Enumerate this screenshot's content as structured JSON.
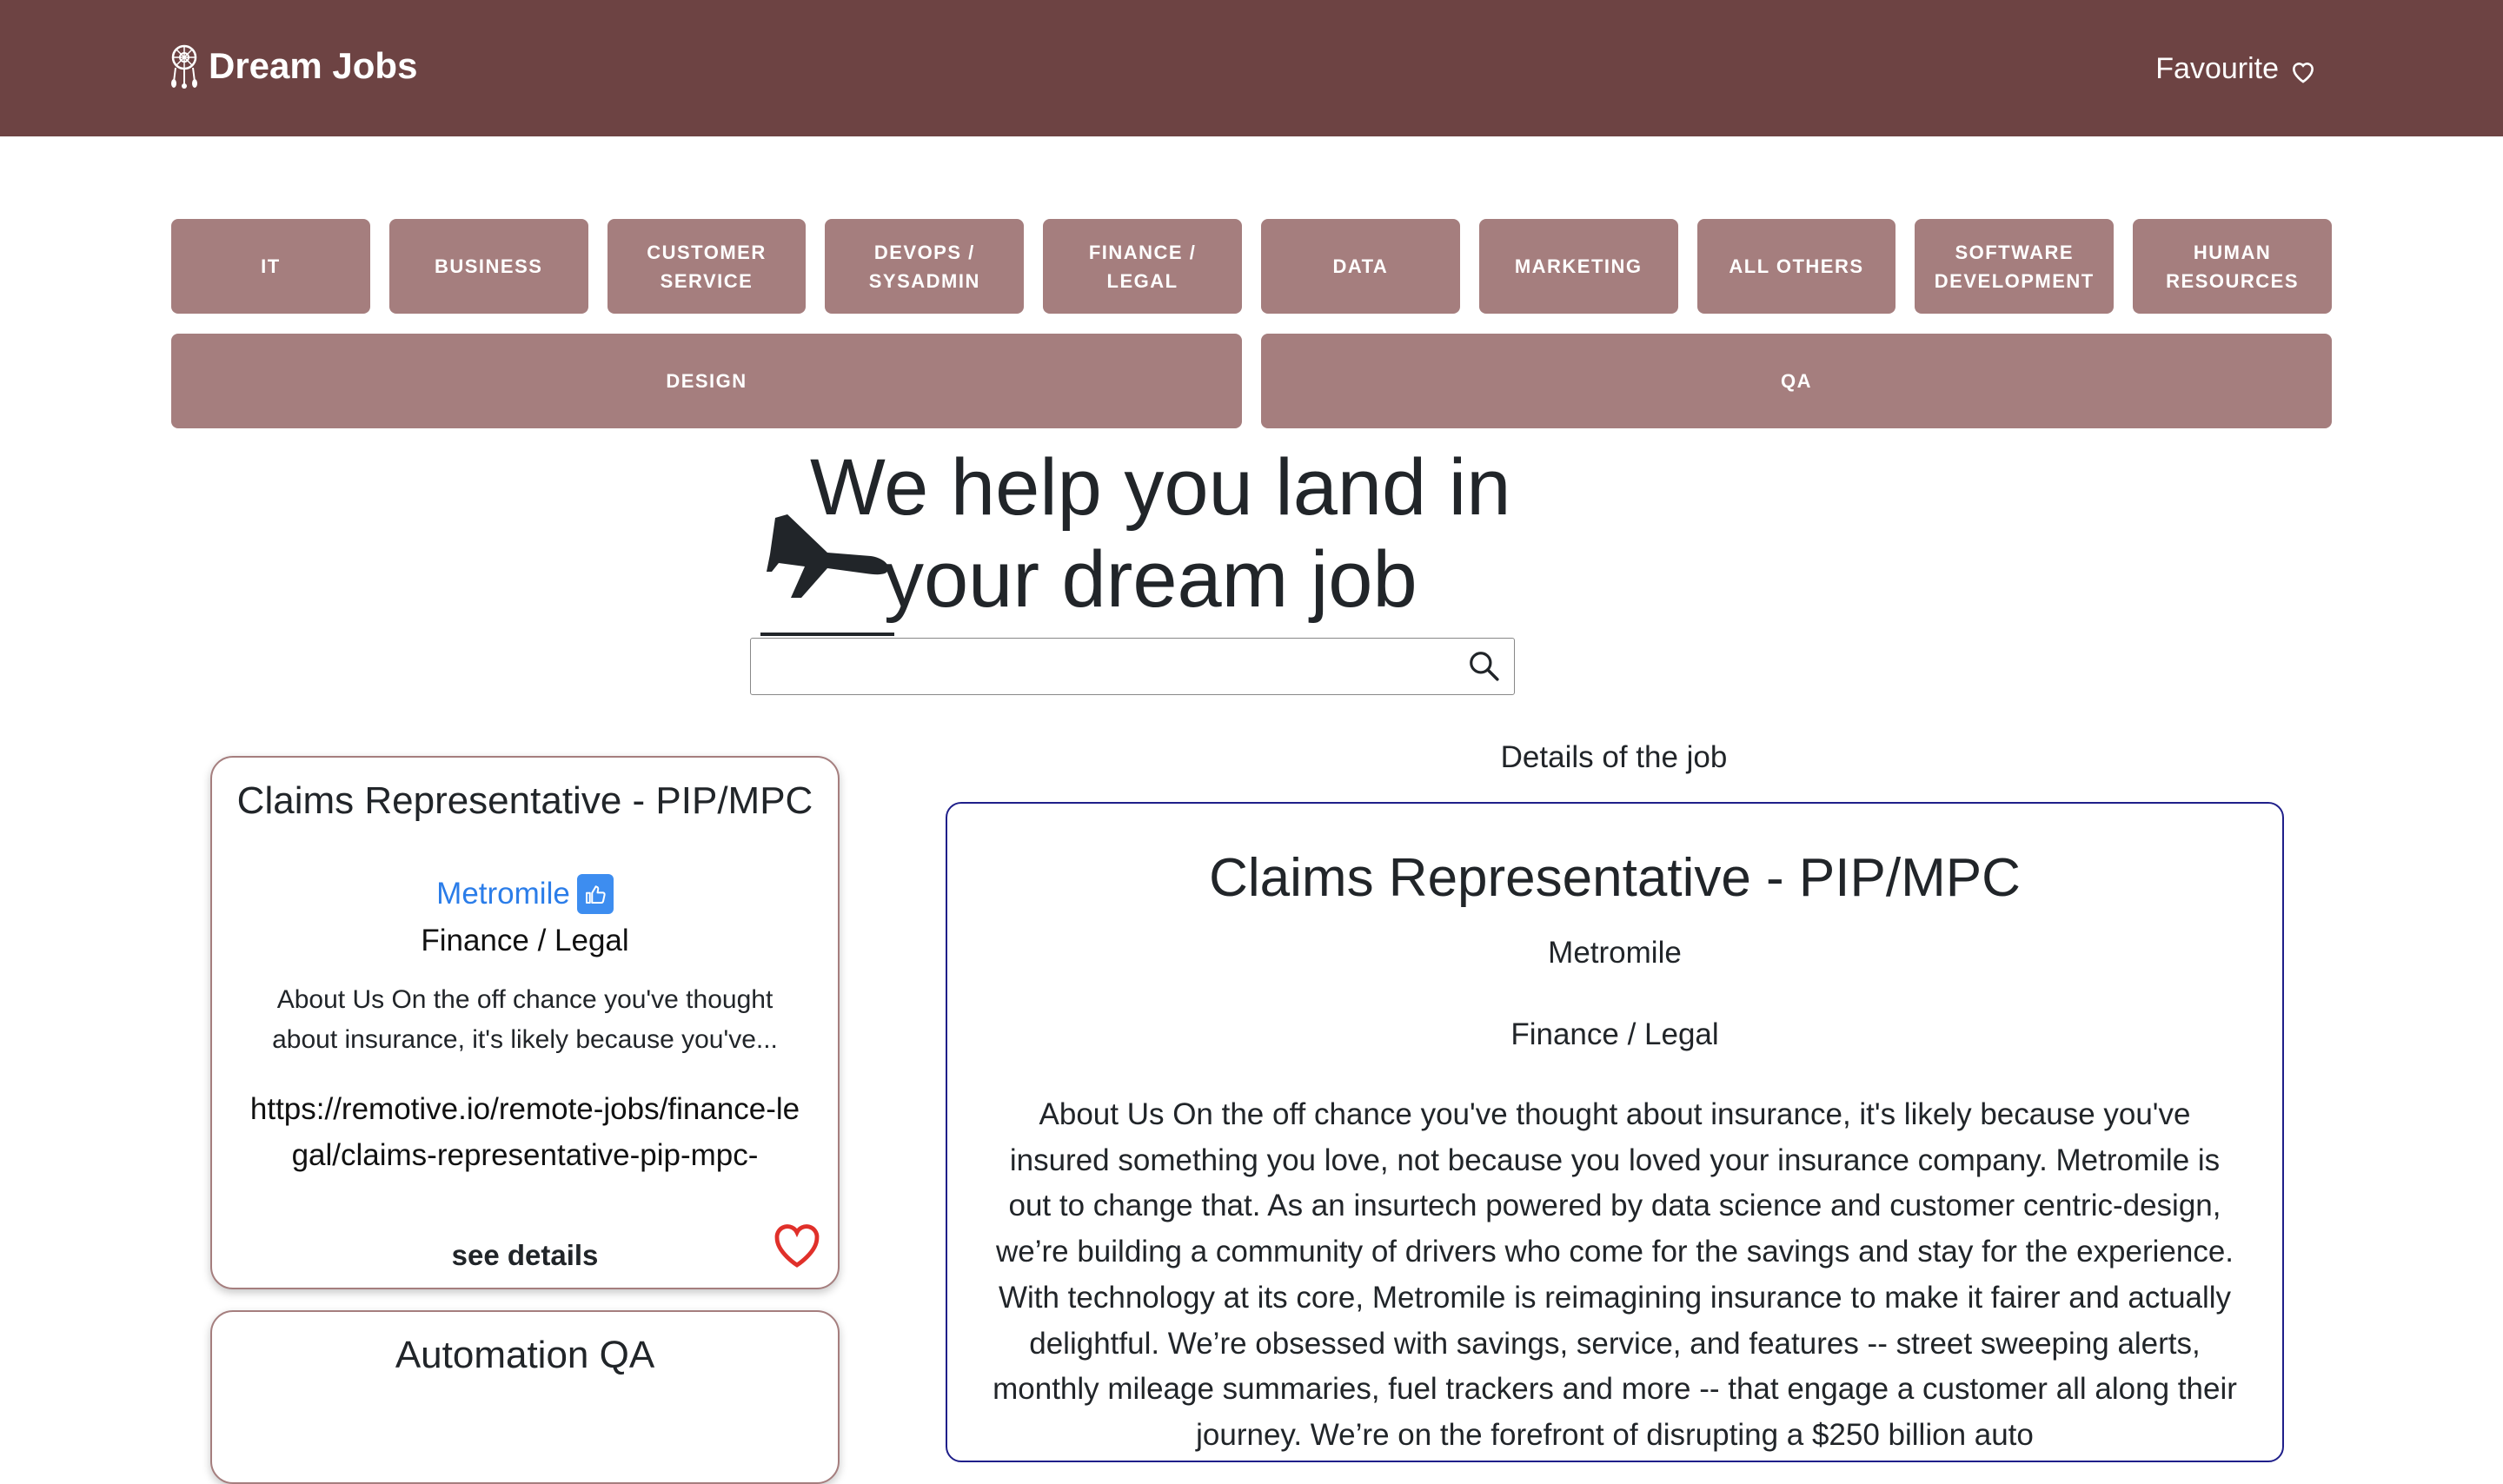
{
  "navbar": {
    "brand": "Dream Jobs",
    "favourite_label": "Favourite"
  },
  "categories": {
    "row1": [
      "IT",
      "BUSINESS",
      "CUSTOMER SERVICE",
      "DEVOPS / SYSADMIN",
      "FINANCE / LEGAL",
      "DATA",
      "MARKETING",
      "ALL OTHERS",
      "SOFTWARE DEVELOPMENT",
      "HUMAN RESOURCES"
    ],
    "row2": [
      "DESIGN",
      "QA"
    ]
  },
  "hero": {
    "line1": "We help you land in",
    "line2": "your dream job"
  },
  "search": {
    "value": "",
    "placeholder": ""
  },
  "job_list": [
    {
      "title": "Claims Representative - PIP/MPC",
      "company": "Metromile",
      "category": "Finance / Legal",
      "description": "About Us  On the off chance you've thought about insurance, it's likely because you've...",
      "url": "https://remotive.io/remote-jobs/finance-legal/claims-representative-pip-mpc-",
      "see_details": "see details"
    },
    {
      "title": "Automation QA"
    }
  ],
  "details": {
    "heading": "Details of the job",
    "title": "Claims Representative - PIP/MPC",
    "company": "Metromile",
    "category": "Finance / Legal",
    "description": "About Us  On the off chance you've thought about insurance, it's likely because you've insured something you love, not because you loved your insurance company. Metromile is out to change that. As an insurtech powered by data science and customer centric-design, we’re building a community of drivers who come for the savings and stay for the experience. With technology at its core, Metromile is reimagining insurance to make it fairer and actually delightful. We’re obsessed with savings, service, and features -- street sweeping alerts, monthly mileage summaries, fuel trackers and more -- that engage a customer all along their journey.  We’re on the forefront of disrupting a $250 billion auto"
  },
  "colors": {
    "navbar": "#6d4343",
    "category_button": "#a57e7e",
    "company_link": "#2b7de9",
    "heart": "#e0302a",
    "details_border": "#1f1f8a"
  }
}
